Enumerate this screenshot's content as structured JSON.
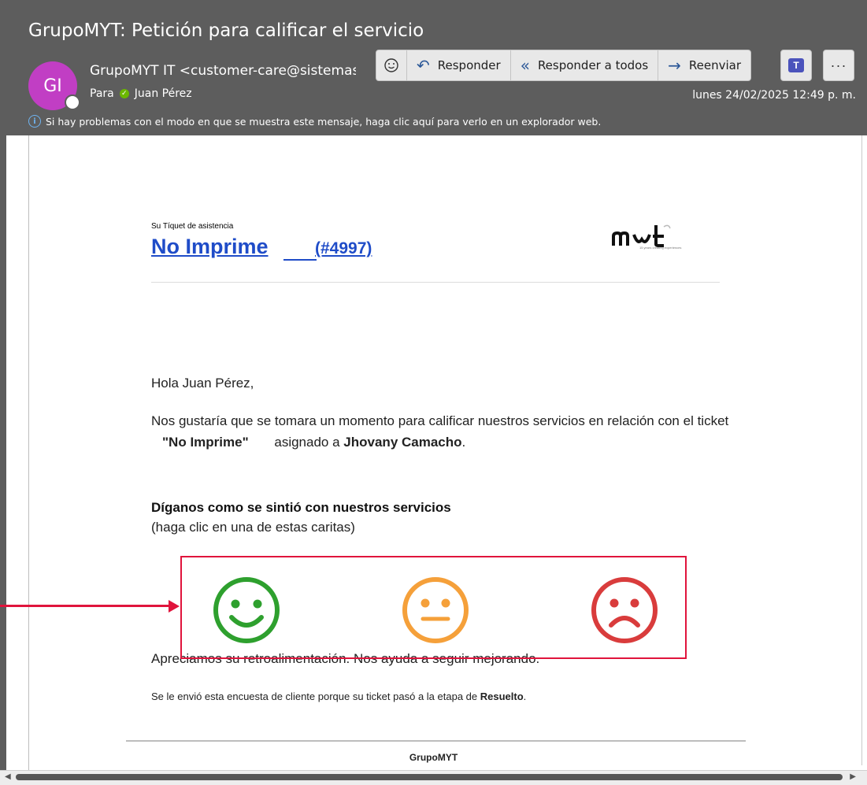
{
  "email": {
    "subject": "GrupoMYT: Petición para calificar el servicio",
    "avatar_initials": "GI",
    "sender": "GrupoMYT IT <customer-care@sistemas",
    "to_label": "Para",
    "to_name": "Juan Pérez",
    "date": "lunes 24/02/2025 12:49 p. m.",
    "info_message": "Si hay problemas con el modo en que se muestra este mensaje, haga clic aquí para verlo en un explorador web."
  },
  "toolbar": {
    "reply": "Responder",
    "reply_all": "Responder a todos",
    "forward": "Reenviar"
  },
  "body": {
    "tiquet_label": "Su Tíquet de asistencia",
    "ticket_title": "No Imprime",
    "ticket_number": "(#4997)",
    "logo_text": "mᵾt",
    "logo_tagline": "15 years creating experiences",
    "greeting": "Hola Juan Pérez,",
    "para_1": "Nos gustaría que se tomara un momento para calificar nuestros servicios en relación con el ticket",
    "para_ticket": "\"No Imprime\"",
    "para_2": "asignado a",
    "assignee": "Jhovany Camacho",
    "period": ".",
    "prompt_title": "Díganos como se sintió con nuestros servicios",
    "prompt_sub": "(haga clic en una de estas caritas)",
    "thanks": "Apreciamos su retroalimentación. Nos ayuda a seguir mejorando.",
    "sent_reason": "Se le envió esta encuesta de cliente porque su ticket pasó a la etapa de",
    "stage": "Resuelto",
    "footer": "GrupoMYT"
  },
  "colors": {
    "happy": "#2ea02e",
    "neutral": "#f5a03a",
    "sad": "#d93c3c",
    "highlight": "#e0143c",
    "link": "#1f4cc8"
  }
}
